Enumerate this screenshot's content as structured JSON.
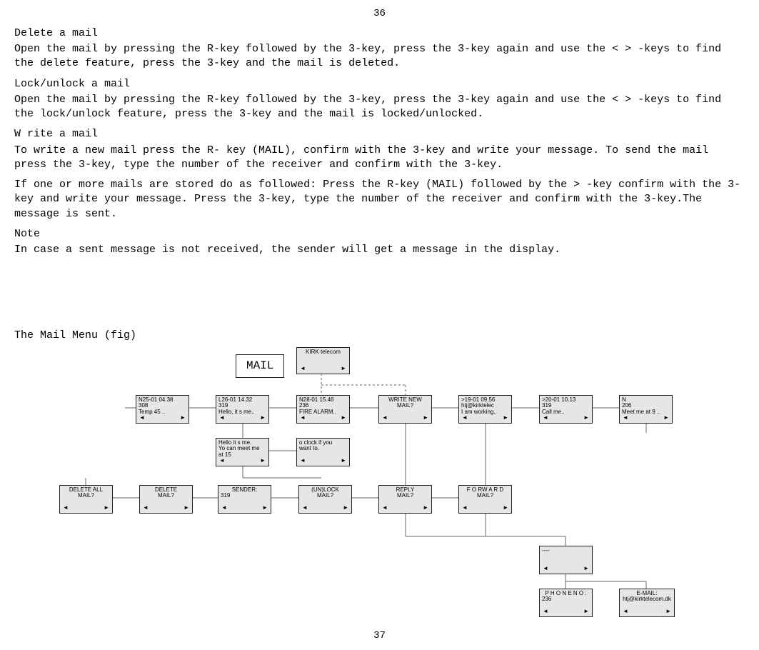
{
  "page_top": "36",
  "page_bottom": "37",
  "sections": {
    "delete": {
      "title": "Delete a mail",
      "body": "Open the mail by pressing the R-key followed by the 3-key, press the 3-key again and use the < > -keys to find the delete feature, press the 3-key and the mail is deleted."
    },
    "lock": {
      "title": "Lock/unlock a mail",
      "body": "Open the mail by pressing the R-key followed by the 3-key, press the 3-key again and use the < > -keys to find the lock/unlock feature, press the 3-key and the mail is locked/unlocked."
    },
    "write": {
      "title": "W rite a mail",
      "body": "To write a new mail press the R- key (MAIL), confirm with the 3-key and write your message. To send the mail press the 3-key, type the number of the receiver and confirm with the 3-key."
    },
    "stored": {
      "body": "If one or more mails are stored do as followed: Press the R-key (MAIL) followed by the > -key confirm with the 3-key and write your message. Press the 3-key, type the number of the receiver and confirm with the 3-key.The message is sent."
    },
    "note": {
      "title": "Note",
      "body": "In case a sent message is not received, the sender will get a message in the display."
    }
  },
  "mailmenu_title": "The Mail Menu (fig)",
  "diagram": {
    "mail_label": "MAIL",
    "kirk": {
      "l1": "KIRK telecom"
    },
    "row1": {
      "b0": {
        "l1": "N25-01 04.38",
        "l2": "308",
        "l3": "Temp 45 .."
      },
      "b1": {
        "l1": "L26-01 14.32",
        "l2": "319",
        "l3": "Hello, it s me.."
      },
      "b2": {
        "l1": "N28-01 15.46",
        "l2": "236",
        "l3": "FIRE ALARM.."
      },
      "b3": {
        "l1": "WRITE NEW",
        "l2": "MAIL?"
      },
      "b4": {
        "l1": ">19-01 09.56",
        "l2": "htj@kirktelec",
        "l3": "I am working.."
      },
      "b5": {
        "l1": ">20-01 10.13",
        "l2": "319",
        "l3": "Call me.."
      },
      "b6": {
        "l1": "N",
        "l2": "206",
        "l3": "Meet me at 9 .."
      }
    },
    "row2": {
      "b0": {
        "l1": "Hello it s me.",
        "l2": "Yo can meet me",
        "l3": "at 15"
      },
      "b1": {
        "l1": "o clock if you",
        "l2": "want to."
      }
    },
    "row3": {
      "b0": {
        "l1": "DELETE ALL",
        "l2": "MAIL?"
      },
      "b1": {
        "l1": "DELETE",
        "l2": "MAIL?"
      },
      "b2": {
        "l1": "SENDER:",
        "l2": "319"
      },
      "b3": {
        "l1": "(UN)LOCK",
        "l2": "MAIL?"
      },
      "b4": {
        "l1": "REPLY",
        "l2": "MAIL?"
      },
      "b5": {
        "l1": "F O RW A R D",
        "l2": "MAIL?"
      }
    },
    "row4": {
      "b0": {
        "l1": "----"
      }
    },
    "row5": {
      "b0": {
        "l1": "P H O N E N O :",
        "l2": "236"
      },
      "b1": {
        "l1": "E-MAIL:",
        "l2": "htj@kirktelecom.dk"
      }
    },
    "arrows": {
      "left": "◄",
      "right": "►"
    }
  }
}
